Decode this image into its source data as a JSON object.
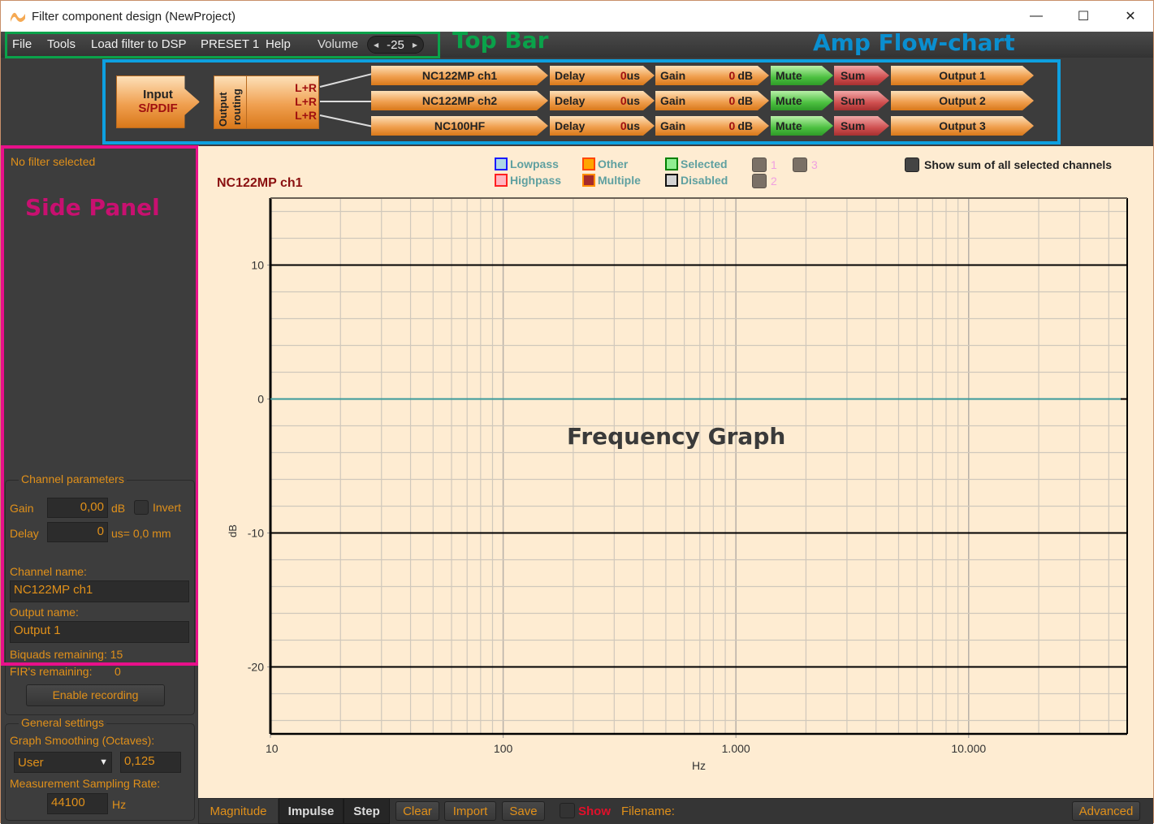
{
  "window": {
    "title": "Filter component design (NewProject)",
    "controls": {
      "minimize": "—",
      "maximize": "☐",
      "close": "✕"
    }
  },
  "menu": {
    "items": [
      "File",
      "Tools",
      "Load filter to DSP",
      "PRESET 1",
      "Help"
    ],
    "volume_label": "Volume",
    "volume_value": "-25"
  },
  "annotations": {
    "top_bar": "Top Bar",
    "amp_flowchart": "Amp Flow-chart",
    "side_panel": "Side Panel",
    "frequency_graph": "Frequency Graph"
  },
  "flowchart": {
    "input_label": "Input",
    "input_source": "S/PDIF",
    "routing_label_1": "Output",
    "routing_label_2": "routing",
    "routing_mix": [
      "L+R",
      "L+R",
      "L+R"
    ],
    "channels": [
      {
        "name": "NC122MP ch1",
        "delay_label": "Delay",
        "delay_value": "0",
        "delay_unit": "us",
        "gain_label": "Gain",
        "gain_value": "0",
        "gain_unit": "dB",
        "mute_label": "Mute",
        "sum_label": "Sum",
        "output": "Output 1"
      },
      {
        "name": "NC122MP ch2",
        "delay_label": "Delay",
        "delay_value": "0",
        "delay_unit": "us",
        "gain_label": "Gain",
        "gain_value": "0",
        "gain_unit": "dB",
        "mute_label": "Mute",
        "sum_label": "Sum",
        "output": "Output 2"
      },
      {
        "name": "NC100HF",
        "delay_label": "Delay",
        "delay_value": "0",
        "delay_unit": "us",
        "gain_label": "Gain",
        "gain_value": "0",
        "gain_unit": "dB",
        "mute_label": "Mute",
        "sum_label": "Sum",
        "output": "Output 3"
      }
    ]
  },
  "side_panel": {
    "filter_status": "No filter selected",
    "channel_params_title": "Channel parameters",
    "gain_label": "Gain",
    "gain_value": "0,00",
    "gain_unit": "dB",
    "invert_label": "Invert",
    "delay_label": "Delay",
    "delay_value": "0",
    "delay_unit": "us= 0,0 mm",
    "channel_name_label": "Channel name:",
    "channel_name_value": "NC122MP ch1",
    "output_name_label": "Output name:",
    "output_name_value": "Output 1",
    "biquads_remaining": "Biquads remaining: 15",
    "firs_label": "FIR's remaining:",
    "firs_value": "0",
    "enable_recording": "Enable recording",
    "general_settings_title": "General settings",
    "smoothing_label": "Graph Smoothing (Octaves):",
    "smoothing_mode": "User",
    "smoothing_value": "0,125",
    "sampling_label": "Measurement Sampling Rate:",
    "sampling_value": "44100",
    "sampling_unit": "Hz"
  },
  "legend": {
    "items": [
      {
        "label": "Lowpass",
        "fill": "#add8e6",
        "border": "#1a1aff"
      },
      {
        "label": "Highpass",
        "fill": "#ffb6c1",
        "border": "#ff2020"
      },
      {
        "label": "Other",
        "fill": "#ffa500",
        "border": "#ff4500"
      },
      {
        "label": "Multiple",
        "fill": "#a52a2a",
        "border": "#ff8c00"
      },
      {
        "label": "Selected",
        "fill": "#90ee90",
        "border": "#008000"
      },
      {
        "label": "Disabled",
        "fill": "#d3d3d3",
        "border": "#111111"
      }
    ],
    "presets": [
      "1",
      "2",
      "3"
    ],
    "show_sum_label": "Show sum of all selected channels"
  },
  "chart_data": {
    "type": "line",
    "title": "NC122MP ch1",
    "xlabel": "Hz",
    "ylabel": "dB",
    "xscale": "log",
    "xlim": [
      10,
      48000
    ],
    "ylim": [
      -25,
      15
    ],
    "x_ticks": [
      10,
      100,
      1000,
      10000
    ],
    "x_tick_labels": [
      "10",
      "100",
      "1.000",
      "10.000"
    ],
    "y_ticks": [
      10,
      0,
      -10,
      -20
    ],
    "y_tick_labels": [
      "10",
      "0",
      "-10",
      "-20"
    ],
    "y_minor_step": 2,
    "grid": true,
    "series": [
      {
        "name": "NC122MP ch1",
        "color": "#3a9a9a",
        "x": [
          10,
          48000
        ],
        "y": [
          0,
          0
        ]
      }
    ]
  },
  "bottom_bar": {
    "tabs": [
      "Magnitude",
      "Impulse",
      "Step"
    ],
    "active_tab": "Magnitude",
    "buttons": [
      "Clear",
      "Import",
      "Save"
    ],
    "show_label": "Show",
    "filename_label": "Filename:",
    "advanced_label": "Advanced"
  },
  "colors": {
    "accent_orange": "#e0901a",
    "graph_bg": "#feecd2",
    "panel_bg": "#3d3d3d"
  }
}
